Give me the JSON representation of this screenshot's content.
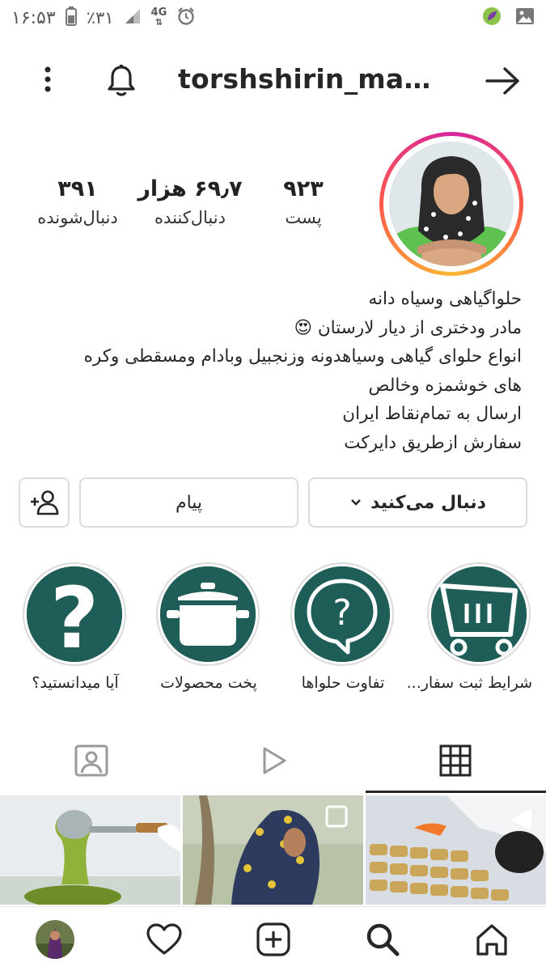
{
  "status_bar": {
    "time": "۱۶:۵۳",
    "battery": "٪۳۱",
    "network": "4G"
  },
  "header": {
    "username": "torshshirin_mam..."
  },
  "profile": {
    "stats": {
      "posts_value": "۹۲۳",
      "posts_label": "پست",
      "followers_value": "۶۹٫۷ هزار",
      "followers_label": "دنبال‌کننده",
      "following_value": "۳۹۱",
      "following_label": "دنبال‌شونده"
    },
    "bio_lines": [
      "حلواگیاهی وسیاه دانه",
      "مادر ودختری از دیار  لارستان 😍",
      "انواع حلوای گیاهی وسیاهدونه وزنجبیل وبادام ومسقطی وکره",
      "های خوشمزه وخالص",
      "ارسال به تمام‌نقاط ایران",
      "سفارش ازطریق دایرکت"
    ]
  },
  "actions": {
    "follow_label": "دنبال می‌کنید",
    "message_label": "پیام"
  },
  "highlights": [
    {
      "label": "شرایط ثبت سفار...",
      "icon": "cart-icon"
    },
    {
      "label": "تفاوت حلواها",
      "icon": "question-bubble-icon"
    },
    {
      "label": "پخت محصولات",
      "icon": "pot-icon"
    },
    {
      "label": "آیا میدانستید؟",
      "icon": "question-mark-icon"
    }
  ],
  "tabs": [
    {
      "name": "grid",
      "icon": "grid-icon",
      "active": true
    },
    {
      "name": "reels",
      "icon": "play-icon",
      "active": false
    },
    {
      "name": "tagged",
      "icon": "tagged-person-icon",
      "active": false
    }
  ],
  "bottom_nav": [
    {
      "name": "home",
      "icon": "home-icon"
    },
    {
      "name": "search",
      "icon": "search-icon"
    },
    {
      "name": "new-post",
      "icon": "add-post-icon"
    },
    {
      "name": "activity",
      "icon": "heart-icon"
    },
    {
      "name": "profile",
      "icon": "profile-avatar"
    }
  ],
  "colors": {
    "highlight_bg": "#1f5d58",
    "border": "#dbdbdb",
    "text": "#262626"
  }
}
